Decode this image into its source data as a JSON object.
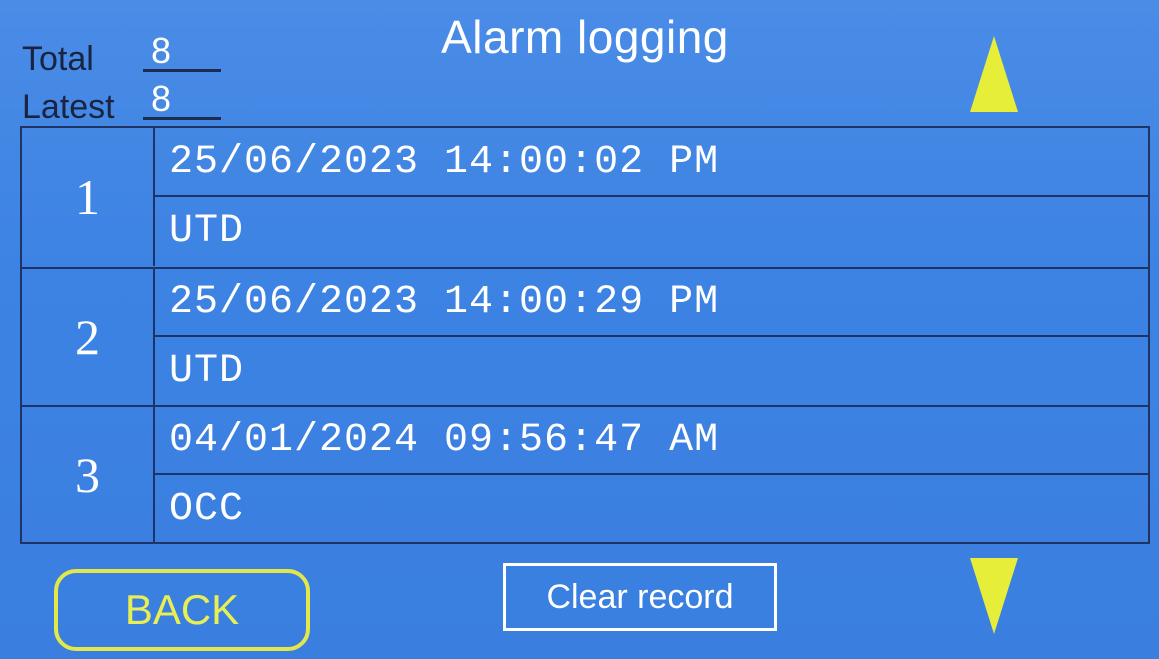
{
  "header": {
    "title": "Alarm logging",
    "total_label": "Total",
    "total_value": "8",
    "latest_label": "Latest",
    "latest_value": "8"
  },
  "log": {
    "rows": [
      {
        "index": "1",
        "time": "25/06/2023 14:00:02 PM",
        "code": "UTD"
      },
      {
        "index": "2",
        "time": "25/06/2023 14:00:29 PM",
        "code": "UTD"
      },
      {
        "index": "3",
        "time": "04/01/2024 09:56:47 AM",
        "code": "OCC"
      }
    ]
  },
  "footer": {
    "back_label": "BACK",
    "clear_label": "Clear record"
  },
  "icons": {
    "scroll_up": "triangle-up-icon",
    "scroll_down": "triangle-down-icon"
  },
  "colors": {
    "background": "#3d83e3",
    "accent_yellow": "#e6ee3a",
    "text": "#ffffff",
    "grid_line": "#1f3466"
  }
}
